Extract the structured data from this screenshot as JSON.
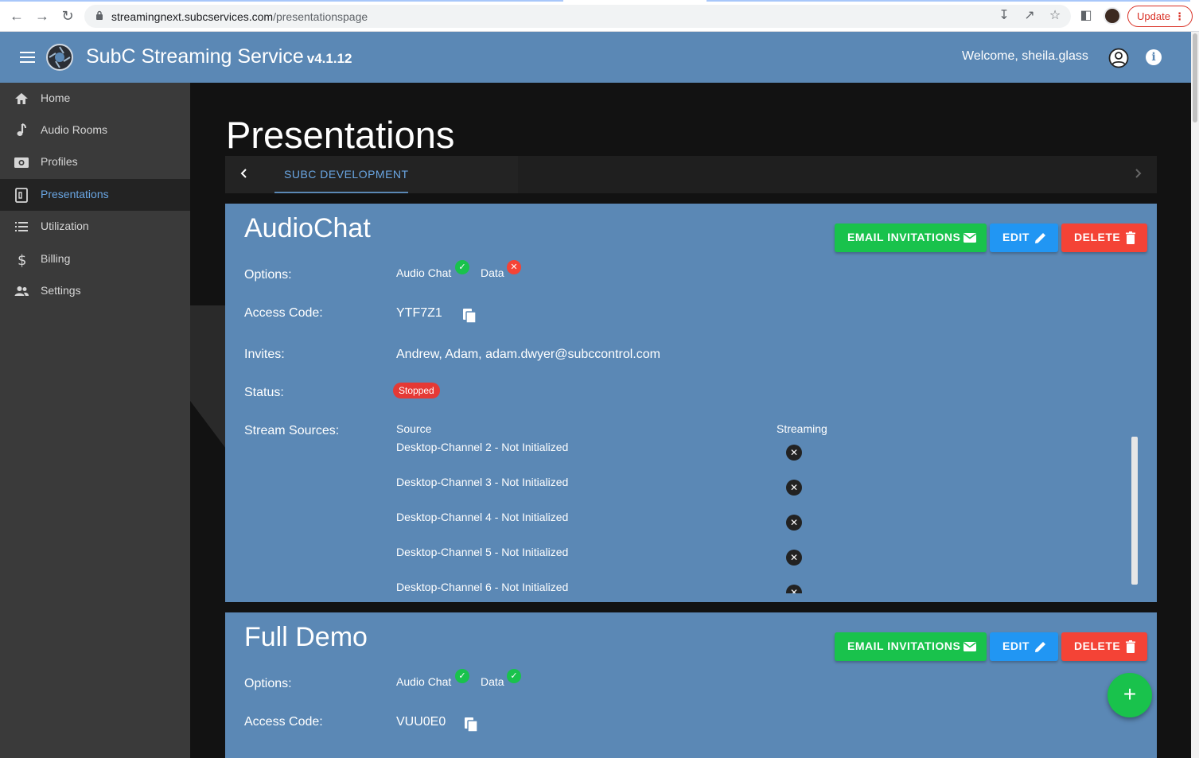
{
  "browser": {
    "url_host": "streamingnext.subcservices.com",
    "url_path": "/presentationspage",
    "update_label": "Update"
  },
  "app": {
    "title": "SubC Streaming Service",
    "version": "v4.1.12",
    "welcome": "Welcome, sheila.glass"
  },
  "sidebar": {
    "items": [
      {
        "label": "Home",
        "icon": "home-icon"
      },
      {
        "label": "Audio Rooms",
        "icon": "music-note-icon"
      },
      {
        "label": "Profiles",
        "icon": "camera-icon"
      },
      {
        "label": "Presentations",
        "icon": "clipboard-icon",
        "active": true
      },
      {
        "label": "Utilization",
        "icon": "list-icon"
      },
      {
        "label": "Billing",
        "icon": "dollar-icon"
      },
      {
        "label": "Settings",
        "icon": "people-icon"
      }
    ]
  },
  "page": {
    "heading": "Presentations",
    "tab_label": "SUBC DEVELOPMENT"
  },
  "buttons": {
    "email": "EMAIL INVITATIONS",
    "edit": "EDIT",
    "delete": "DELETE"
  },
  "labels": {
    "options": "Options:",
    "access_code": "Access Code:",
    "invites": "Invites:",
    "status": "Status:",
    "stream_sources": "Stream Sources:",
    "source_col": "Source",
    "streaming_col": "Streaming",
    "audio_chat": "Audio Chat",
    "data": "Data"
  },
  "presentations": [
    {
      "title": "AudioChat",
      "audio_chat_enabled": true,
      "data_enabled": false,
      "access_code": "YTF7Z1",
      "invites": "Andrew, Adam, adam.dwyer@subccontrol.com",
      "status": "Stopped",
      "status_color": "#e53935",
      "sources": [
        {
          "name": "Desktop-Channel 2 - Not Initialized",
          "streaming": false
        },
        {
          "name": "Desktop-Channel 3 - Not Initialized",
          "streaming": false
        },
        {
          "name": "Desktop-Channel 4 - Not Initialized",
          "streaming": false
        },
        {
          "name": "Desktop-Channel 5 - Not Initialized",
          "streaming": false
        },
        {
          "name": "Desktop-Channel 6 - Not Initialized",
          "streaming": false
        }
      ]
    },
    {
      "title": "Full Demo",
      "audio_chat_enabled": true,
      "data_enabled": true,
      "access_code": "VUU0E0"
    }
  ],
  "colors": {
    "accent": "#5b88b5",
    "success": "#19c24c",
    "primary": "#2196f3",
    "danger": "#f44336"
  }
}
